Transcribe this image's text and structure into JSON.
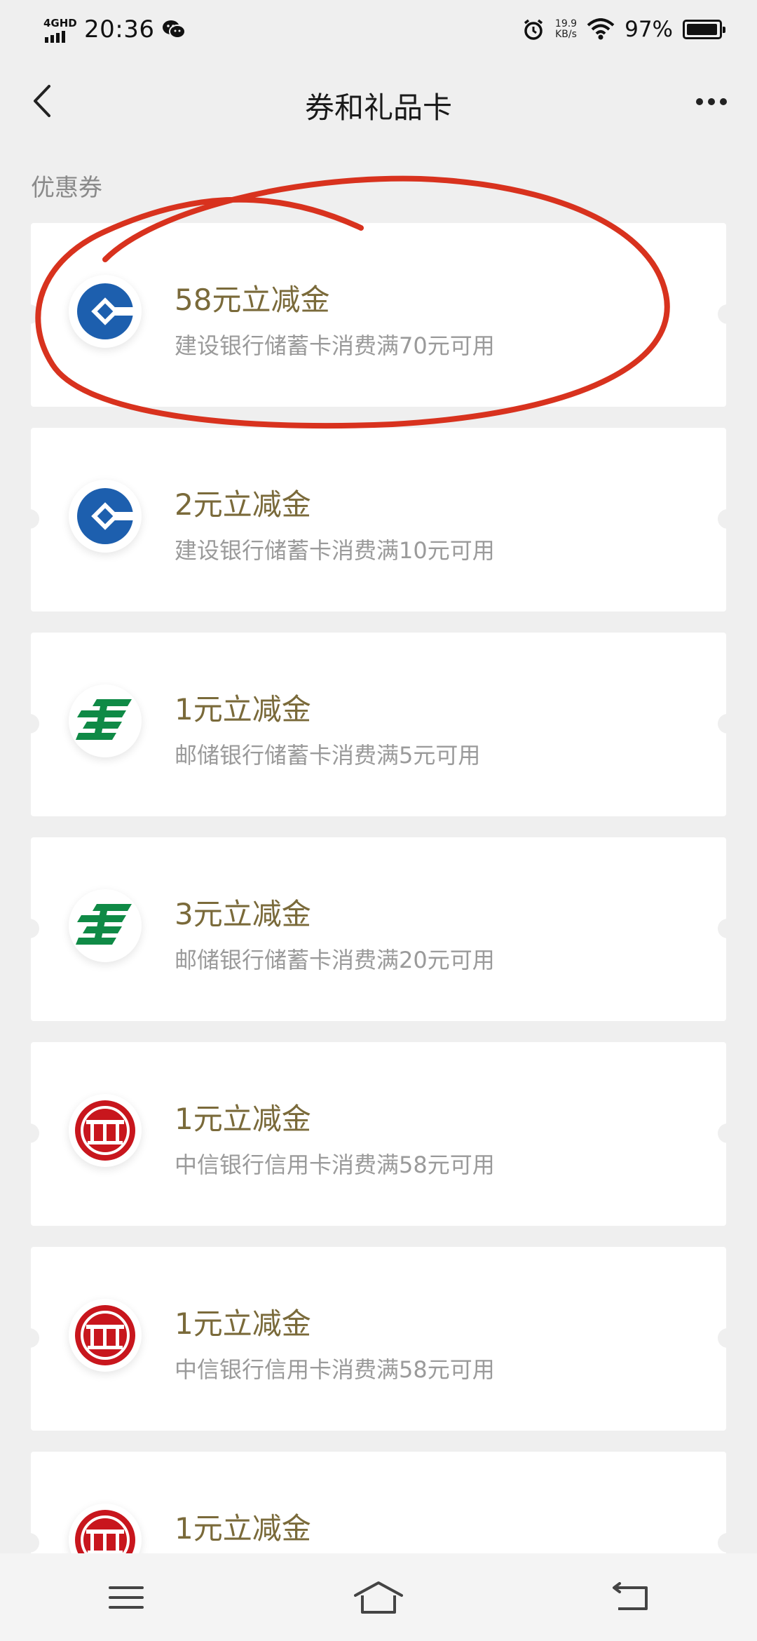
{
  "status_bar": {
    "network": "4GHD",
    "time": "20:36",
    "speed_value": "19.9",
    "speed_unit": "KB/s",
    "battery_pct": "97%",
    "battery_level": 0.97
  },
  "nav": {
    "title": "券和礼品卡"
  },
  "section_label": "优惠券",
  "coupons": [
    {
      "title": "58元立减金",
      "desc": "建设银行储蓄卡消费满70元可用",
      "bank": "ccb"
    },
    {
      "title": "2元立减金",
      "desc": "建设银行储蓄卡消费满10元可用",
      "bank": "ccb"
    },
    {
      "title": "1元立减金",
      "desc": "邮储银行储蓄卡消费满5元可用",
      "bank": "psbc"
    },
    {
      "title": "3元立减金",
      "desc": "邮储银行储蓄卡消费满20元可用",
      "bank": "psbc"
    },
    {
      "title": "1元立减金",
      "desc": "中信银行信用卡消费满58元可用",
      "bank": "citic"
    },
    {
      "title": "1元立减金",
      "desc": "中信银行信用卡消费满58元可用",
      "bank": "citic"
    },
    {
      "title": "1元立减金",
      "desc": "",
      "bank": "citic"
    }
  ],
  "colors": {
    "ccb_blue": "#1d5fae",
    "psbc_green": "#0f8a46",
    "citic_red": "#c8161d",
    "annotation_red": "#d8321e",
    "coupon_title": "#7a6a3a"
  },
  "icons": {
    "back": "chevron-left-icon",
    "more": "more-dots-icon",
    "menu": "menu-icon",
    "home": "home-icon",
    "return": "return-icon"
  }
}
